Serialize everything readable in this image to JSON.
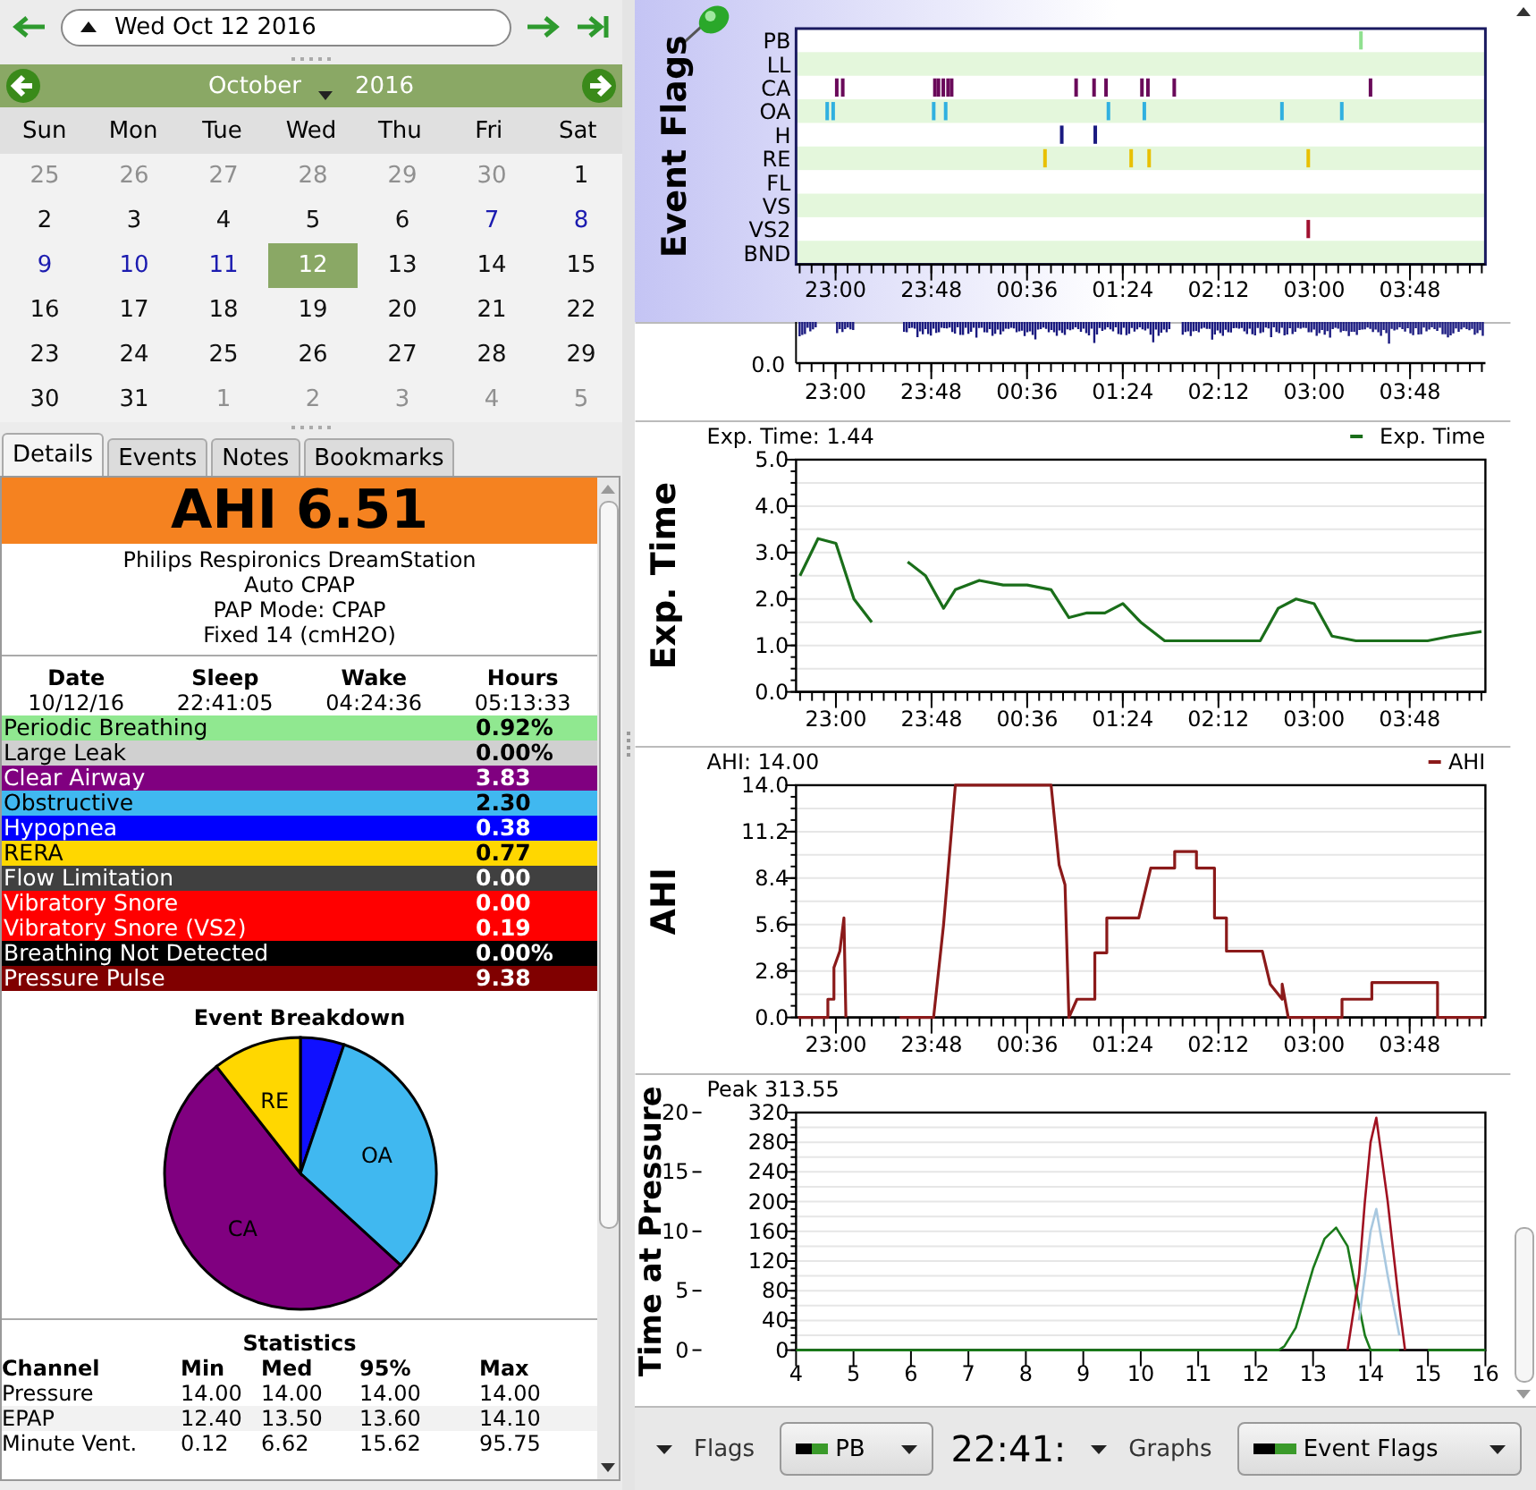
{
  "navigation": {
    "date": "Wed Oct 12 2016"
  },
  "calendar": {
    "month": "October",
    "year": "2016",
    "weekdays": [
      "Sun",
      "Mon",
      "Tue",
      "Wed",
      "Thu",
      "Fri",
      "Sat"
    ],
    "days": [
      {
        "day": "25",
        "in_month": false,
        "has_data": false,
        "selected": false
      },
      {
        "day": "26",
        "in_month": false,
        "has_data": false,
        "selected": false
      },
      {
        "day": "27",
        "in_month": false,
        "has_data": false,
        "selected": false
      },
      {
        "day": "28",
        "in_month": false,
        "has_data": false,
        "selected": false
      },
      {
        "day": "29",
        "in_month": false,
        "has_data": false,
        "selected": false
      },
      {
        "day": "30",
        "in_month": false,
        "has_data": false,
        "selected": false
      },
      {
        "day": "1",
        "in_month": true,
        "has_data": false,
        "selected": false
      },
      {
        "day": "2",
        "in_month": true,
        "has_data": false,
        "selected": false
      },
      {
        "day": "3",
        "in_month": true,
        "has_data": false,
        "selected": false
      },
      {
        "day": "4",
        "in_month": true,
        "has_data": false,
        "selected": false
      },
      {
        "day": "5",
        "in_month": true,
        "has_data": false,
        "selected": false
      },
      {
        "day": "6",
        "in_month": true,
        "has_data": false,
        "selected": false
      },
      {
        "day": "7",
        "in_month": true,
        "has_data": true,
        "selected": false
      },
      {
        "day": "8",
        "in_month": true,
        "has_data": true,
        "selected": false
      },
      {
        "day": "9",
        "in_month": true,
        "has_data": true,
        "selected": false
      },
      {
        "day": "10",
        "in_month": true,
        "has_data": true,
        "selected": false
      },
      {
        "day": "11",
        "in_month": true,
        "has_data": true,
        "selected": false
      },
      {
        "day": "12",
        "in_month": true,
        "has_data": true,
        "selected": true
      },
      {
        "day": "13",
        "in_month": true,
        "has_data": false,
        "selected": false
      },
      {
        "day": "14",
        "in_month": true,
        "has_data": false,
        "selected": false
      },
      {
        "day": "15",
        "in_month": true,
        "has_data": false,
        "selected": false
      },
      {
        "day": "16",
        "in_month": true,
        "has_data": false,
        "selected": false
      },
      {
        "day": "17",
        "in_month": true,
        "has_data": false,
        "selected": false
      },
      {
        "day": "18",
        "in_month": true,
        "has_data": false,
        "selected": false
      },
      {
        "day": "19",
        "in_month": true,
        "has_data": false,
        "selected": false
      },
      {
        "day": "20",
        "in_month": true,
        "has_data": false,
        "selected": false
      },
      {
        "day": "21",
        "in_month": true,
        "has_data": false,
        "selected": false
      },
      {
        "day": "22",
        "in_month": true,
        "has_data": false,
        "selected": false
      },
      {
        "day": "23",
        "in_month": true,
        "has_data": false,
        "selected": false
      },
      {
        "day": "24",
        "in_month": true,
        "has_data": false,
        "selected": false
      },
      {
        "day": "25",
        "in_month": true,
        "has_data": false,
        "selected": false
      },
      {
        "day": "26",
        "in_month": true,
        "has_data": false,
        "selected": false
      },
      {
        "day": "27",
        "in_month": true,
        "has_data": false,
        "selected": false
      },
      {
        "day": "28",
        "in_month": true,
        "has_data": false,
        "selected": false
      },
      {
        "day": "29",
        "in_month": true,
        "has_data": false,
        "selected": false
      },
      {
        "day": "30",
        "in_month": true,
        "has_data": false,
        "selected": false
      },
      {
        "day": "31",
        "in_month": true,
        "has_data": false,
        "selected": false
      },
      {
        "day": "1",
        "in_month": false,
        "has_data": false,
        "selected": false
      },
      {
        "day": "2",
        "in_month": false,
        "has_data": false,
        "selected": false
      },
      {
        "day": "3",
        "in_month": false,
        "has_data": false,
        "selected": false
      },
      {
        "day": "4",
        "in_month": false,
        "has_data": false,
        "selected": false
      },
      {
        "day": "5",
        "in_month": false,
        "has_data": false,
        "selected": false
      }
    ]
  },
  "tabs": [
    {
      "label": "Details",
      "selected": true
    },
    {
      "label": "Events",
      "selected": false
    },
    {
      "label": "Notes",
      "selected": false
    },
    {
      "label": "Bookmarks",
      "selected": false
    }
  ],
  "details": {
    "ahi": "AHI 6.51",
    "machine": [
      "Philips Respironics DreamStation",
      "Auto CPAP",
      "PAP Mode: CPAP",
      "Fixed 14 (cmH2O)"
    ],
    "session": {
      "columns": [
        "Date",
        "Sleep",
        "Wake",
        "Hours"
      ],
      "values": [
        "10/12/16",
        "22:41:05",
        "04:24:36",
        "05:13:33"
      ]
    },
    "events": [
      {
        "name": "Periodic Breathing",
        "value": "0.92%",
        "color": "#90e890"
      },
      {
        "name": "Large Leak",
        "value": "0.00%",
        "color": "#d0d0d0"
      },
      {
        "name": "Clear Airway",
        "value": "3.83",
        "color": "#800080"
      },
      {
        "name": "Obstructive",
        "value": "2.30",
        "color": "#40b8f0"
      },
      {
        "name": "Hypopnea",
        "value": "0.38",
        "color": "#0000ff"
      },
      {
        "name": "RERA",
        "value": "0.77",
        "color": "#ffd700"
      },
      {
        "name": "Flow Limitation",
        "value": "0.00",
        "color": "#404040"
      },
      {
        "name": "Vibratory Snore",
        "value": "0.00",
        "color": "#ff0000"
      },
      {
        "name": "Vibratory Snore (VS2)",
        "value": "0.19",
        "color": "#ff0000"
      },
      {
        "name": "Breathing Not Detected",
        "value": "0.00%",
        "color": "#000000"
      },
      {
        "name": "Pressure Pulse",
        "value": "9.38",
        "color": "#800000"
      }
    ],
    "breakdown": {
      "chart_data": {
        "type": "pie",
        "title": "Event Breakdown",
        "categories": [
          null,
          "OA",
          "CA",
          "RE"
        ],
        "values": [
          5.2,
          31.6,
          52.6,
          10.6
        ],
        "colors": [
          "#1010ff",
          "#40b8f0",
          "#800080",
          "#ffd700"
        ]
      }
    },
    "statistics": {
      "title": "Statistics",
      "columns": [
        "Channel",
        "Min",
        "Med",
        "95%",
        "Max"
      ],
      "rows": [
        [
          "Pressure",
          "14.00",
          "14.00",
          "14.00",
          "14.00"
        ],
        [
          "EPAP",
          "12.40",
          "13.50",
          "13.60",
          "14.10"
        ],
        [
          "Minute Vent.",
          "0.12",
          "6.62",
          "15.62",
          "95.75"
        ]
      ]
    }
  },
  "graphs": [
    {
      "kind": "flags",
      "title": "Event Flags",
      "selected": true,
      "rows": [
        {
          "label": "PB",
          "color": "#90e090"
        },
        {
          "label": "LL"
        },
        {
          "label": "CA",
          "color": "#6a0a5a"
        },
        {
          "label": "OA",
          "color": "#30b0e0"
        },
        {
          "label": "H",
          "color": "#1a1a80"
        },
        {
          "label": "RE",
          "color": "#e8c000"
        },
        {
          "label": "FL"
        },
        {
          "label": "VS"
        },
        {
          "label": "VS2",
          "color": "#a01030"
        },
        {
          "label": "BND"
        }
      ],
      "time_labels": [
        "23:00",
        "23:48",
        "00:36",
        "01:24",
        "02:12",
        "03:00",
        "03:48"
      ]
    },
    {
      "kind": "waveform",
      "selected": false,
      "axis": {
        "y_label": "0.0",
        "x_labels": [
          "23:00",
          "23:48",
          "00:36",
          "01:24",
          "02:12",
          "03:00",
          "03:48"
        ]
      }
    },
    {
      "kind": "line",
      "selected": false,
      "readout": "Exp. Time: 1.44",
      "chart_data": {
        "type": "line",
        "ylabel": "Exp. Time",
        "grid": true,
        "xlim": [
          "2016-10-12 22:40",
          "2016-10-13 04:26"
        ],
        "ylim": [
          0,
          5
        ],
        "xticks": [
          {
            "value": "2016-10-12 23:00",
            "label": "23:00"
          },
          {
            "value": "2016-10-12 23:48",
            "label": "23:48"
          },
          {
            "value": "2016-10-13 00:36",
            "label": "00:36"
          },
          {
            "value": "2016-10-13 01:24",
            "label": "01:24"
          },
          {
            "value": "2016-10-13 02:12",
            "label": "02:12"
          },
          {
            "value": "2016-10-13 03:00",
            "label": "03:00"
          },
          {
            "value": "2016-10-13 03:48",
            "label": "03:48"
          }
        ],
        "yticks": [
          {
            "value": 0,
            "label": "0.0"
          },
          {
            "value": 1,
            "label": "1.0"
          },
          {
            "value": 2,
            "label": "2.0"
          },
          {
            "value": 3,
            "label": "3.0"
          },
          {
            "value": 4,
            "label": "4.0"
          },
          {
            "value": 5,
            "label": "5.0"
          }
        ],
        "x": [
          "2016-10-12 22:42",
          "2016-10-12 22:51",
          "2016-10-12 23:00",
          "2016-10-12 23:09",
          "2016-10-12 23:18",
          "2016-10-12 23:24",
          "2016-10-12 23:36",
          "2016-10-12 23:45",
          "2016-10-12 23:54",
          "2016-10-13 00:00",
          "2016-10-13 00:12",
          "2016-10-13 00:24",
          "2016-10-13 00:36",
          "2016-10-13 00:48",
          "2016-10-13 00:57",
          "2016-10-13 01:06",
          "2016-10-13 01:15",
          "2016-10-13 01:24",
          "2016-10-13 01:33",
          "2016-10-13 01:45",
          "2016-10-13 01:57",
          "2016-10-13 02:09",
          "2016-10-13 02:21",
          "2016-10-13 02:33",
          "2016-10-13 02:42",
          "2016-10-13 02:51",
          "2016-10-13 03:00",
          "2016-10-13 03:09",
          "2016-10-13 03:21",
          "2016-10-13 03:33",
          "2016-10-13 03:45",
          "2016-10-13 03:57",
          "2016-10-13 04:09",
          "2016-10-13 04:24"
        ],
        "series": [
          {
            "name": "Exp. Time",
            "color": "#1a6e1a",
            "values": [
              2.5,
              3.3,
              3.2,
              2.0,
              1.5,
              null,
              2.8,
              2.5,
              1.8,
              2.2,
              2.4,
              2.3,
              2.3,
              2.2,
              1.6,
              1.7,
              1.7,
              1.9,
              1.5,
              1.1,
              1.1,
              1.1,
              1.1,
              1.1,
              1.8,
              2.0,
              1.9,
              1.2,
              1.1,
              1.1,
              1.1,
              1.1,
              1.2,
              1.3
            ]
          }
        ]
      }
    },
    {
      "kind": "line",
      "selected": false,
      "readout": "AHI: 14.00",
      "chart_data": {
        "type": "line",
        "ylabel": "AHI",
        "grid": true,
        "xlim": [
          "2016-10-12 22:40",
          "2016-10-13 04:26"
        ],
        "ylim": [
          0,
          14
        ],
        "xticks": [
          {
            "value": "2016-10-12 23:00",
            "label": "23:00"
          },
          {
            "value": "2016-10-12 23:48",
            "label": "23:48"
          },
          {
            "value": "2016-10-13 00:36",
            "label": "00:36"
          },
          {
            "value": "2016-10-13 01:24",
            "label": "01:24"
          },
          {
            "value": "2016-10-13 02:12",
            "label": "02:12"
          },
          {
            "value": "2016-10-13 03:00",
            "label": "03:00"
          },
          {
            "value": "2016-10-13 03:48",
            "label": "03:48"
          }
        ],
        "yticks": [
          {
            "value": 0,
            "label": "0.0"
          },
          {
            "value": 2.8,
            "label": "2.8"
          },
          {
            "value": 5.6,
            "label": "5.6"
          },
          {
            "value": 8.4,
            "label": "8.4"
          },
          {
            "value": 11.2,
            "label": "11.2"
          },
          {
            "value": 14,
            "label": "14.0"
          }
        ],
        "x": [
          "2016-10-12 22:41",
          "2016-10-12 22:56",
          "2016-10-12 22:56",
          "2016-10-12 22:59",
          "2016-10-12 22:59",
          "2016-10-12 23:02",
          "2016-10-12 23:04",
          "2016-10-12 23:05",
          "2016-10-12 23:18",
          "2016-10-12 23:32",
          "2016-10-12 23:49",
          "2016-10-12 23:54",
          "2016-10-13 00:00",
          "2016-10-13 00:48",
          "2016-10-13 00:52",
          "2016-10-13 00:55",
          "2016-10-13 00:57",
          "2016-10-13 01:01",
          "2016-10-13 01:10",
          "2016-10-13 01:10",
          "2016-10-13 01:16",
          "2016-10-13 01:16",
          "2016-10-13 01:32",
          "2016-10-13 01:38",
          "2016-10-13 01:50",
          "2016-10-13 01:50",
          "2016-10-13 02:01",
          "2016-10-13 02:01",
          "2016-10-13 02:10",
          "2016-10-13 02:10",
          "2016-10-13 02:16",
          "2016-10-13 02:16",
          "2016-10-13 02:34",
          "2016-10-13 02:38",
          "2016-10-13 02:44",
          "2016-10-13 02:44",
          "2016-10-13 02:47",
          "2016-10-13 03:14",
          "2016-10-13 03:14",
          "2016-10-13 03:29",
          "2016-10-13 03:29",
          "2016-10-13 04:02",
          "2016-10-13 04:02",
          "2016-10-13 04:25"
        ],
        "series": [
          {
            "name": "AHI",
            "color": "#8b1a1a",
            "values": [
              0,
              0,
              1.1,
              1.1,
              3,
              4,
              6,
              0,
              null,
              0,
              0,
              5.6,
              14,
              14,
              9.2,
              8,
              0,
              1.1,
              1.1,
              3.9,
              3.9,
              6,
              6,
              9,
              9,
              10,
              10,
              9,
              9,
              6,
              6,
              4,
              4,
              2,
              1.1,
              2,
              0,
              0,
              1.1,
              1.1,
              2.1,
              2.1,
              0,
              0
            ]
          }
        ]
      }
    },
    {
      "kind": "pressure",
      "selected": false,
      "readout": "Peak 313.55",
      "chart_data": {
        "type": "line",
        "ylabel": "Time at Pressure",
        "grid": true,
        "xlim": [
          4,
          16
        ],
        "ylim": [
          0,
          320
        ],
        "xticks": [
          4,
          5,
          6,
          7,
          8,
          9,
          10,
          11,
          12,
          13,
          14,
          15,
          16
        ],
        "yticks": [
          0,
          40,
          80,
          120,
          160,
          200,
          240,
          280,
          320
        ],
        "annotations": [
          "0",
          "5",
          "10",
          "15",
          "20"
        ],
        "x": [
          4,
          11.6,
          12.4,
          12.5,
          12.7,
          13,
          13.2,
          13.4,
          13.6,
          13.8,
          13.9,
          14,
          14.1,
          14.3,
          14.5,
          14.6,
          15,
          16
        ],
        "series": [
          {
            "color": "#1a7a1a",
            "values": [
              0,
              0,
              0,
              5,
              30,
              110,
              150,
              165,
              140,
              60,
              20,
              0,
              0,
              0,
              0,
              null,
              0,
              0
            ]
          },
          {
            "color": "#a8c8e0",
            "values": [
              null,
              null,
              null,
              null,
              null,
              null,
              null,
              null,
              null,
              40,
              100,
              160,
              190,
              100,
              20,
              null,
              null,
              null
            ]
          },
          {
            "color": "#a01020",
            "values": [
              null,
              null,
              null,
              null,
              null,
              null,
              null,
              null,
              0,
              100,
              200,
              280,
              313,
              200,
              60,
              0,
              null,
              null
            ]
          }
        ]
      }
    }
  ],
  "toolbar": {
    "flags_label": "Flags",
    "flag_choice": "PB",
    "time": "22:41:",
    "graphs_label": "Graphs",
    "graph_choice": "Event Flags"
  }
}
